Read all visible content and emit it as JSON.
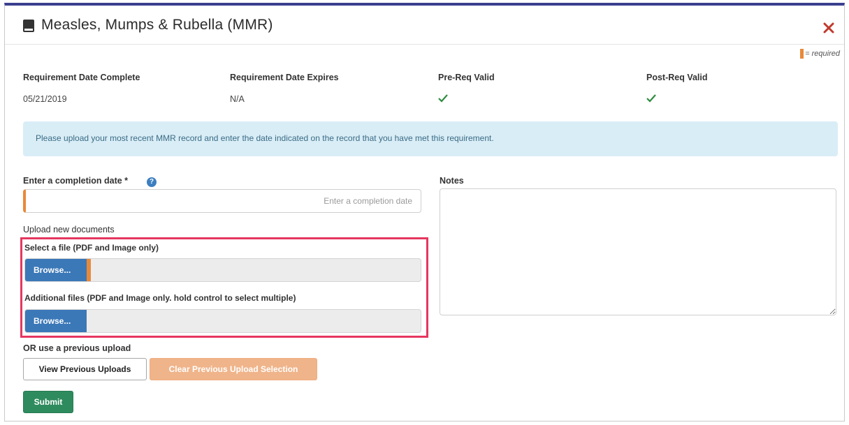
{
  "modal": {
    "title": "Measles, Mumps & Rubella (MMR)",
    "legend_text": "= required"
  },
  "status": {
    "date_complete_label": "Requirement Date Complete",
    "date_complete_value": "05/21/2019",
    "date_expires_label": "Requirement Date Expires",
    "date_expires_value": "N/A",
    "pre_req_label": "Pre-Req Valid",
    "post_req_label": "Post-Req Valid"
  },
  "info_text": "Please upload your most recent MMR record and enter the date indicated on the record that you have met this requirement.",
  "form": {
    "completion_label": "Enter a completion date *",
    "completion_placeholder": "Enter a completion date",
    "completion_value": "",
    "notes_label": "Notes",
    "notes_value": "",
    "upload_heading": "Upload new documents",
    "select_file_label": "Select a file (PDF and Image only)",
    "additional_files_label": "Additional files (PDF and Image only. hold control to select multiple)",
    "browse_label": "Browse...",
    "previous_heading": "OR use a previous upload",
    "view_previous_label": "View Previous Uploads",
    "clear_previous_label": "Clear Previous Upload Selection",
    "submit_label": "Submit"
  },
  "colors": {
    "accent_required": "#e8893a",
    "browse_blue": "#3b78b8",
    "submit_green": "#2e8b5e",
    "highlight_red": "#e5375f",
    "info_bg": "#d9edf6"
  },
  "icons": [
    "book-icon",
    "close-icon",
    "checkmark-icon",
    "help-icon"
  ]
}
